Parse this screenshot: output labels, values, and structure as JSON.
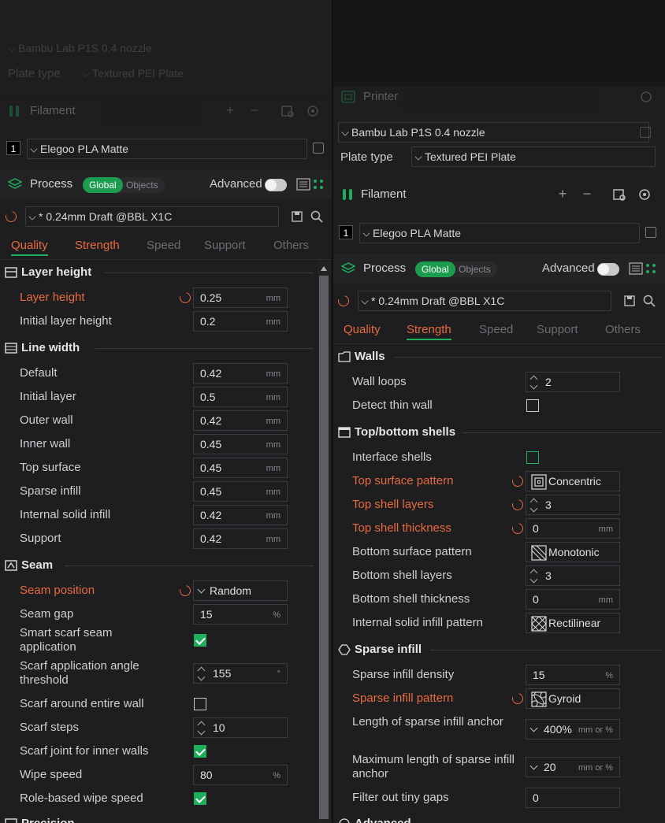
{
  "left": {
    "printer": {
      "preset": "Bambu Lab P1S 0.4 nozzle",
      "plate_label": "Plate type",
      "plate_value": "Textured PEI Plate"
    },
    "filament": {
      "title": "Filament",
      "slot": "1",
      "preset": "Elegoo PLA Matte"
    },
    "process": {
      "title": "Process",
      "global": "Global",
      "objects": "Objects",
      "advanced": "Advanced",
      "preset": "* 0.24mm Draft @BBL X1C"
    },
    "tabs": [
      "Quality",
      "Strength",
      "Speed",
      "Support",
      "Others"
    ],
    "sections": [
      {
        "title": "Layer height"
      },
      {
        "title": "Line width"
      },
      {
        "title": "Seam"
      },
      {
        "title": "Precision"
      }
    ],
    "rows": [
      {
        "label": "Layer height",
        "value": "0.25",
        "unit": "mm"
      },
      {
        "label": "Initial layer height",
        "value": "0.2",
        "unit": "mm"
      },
      {
        "label": "Default",
        "value": "0.42",
        "unit": "mm"
      },
      {
        "label": "Initial layer",
        "value": "0.5",
        "unit": "mm"
      },
      {
        "label": "Outer wall",
        "value": "0.42",
        "unit": "mm"
      },
      {
        "label": "Inner wall",
        "value": "0.45",
        "unit": "mm"
      },
      {
        "label": "Top surface",
        "value": "0.45",
        "unit": "mm"
      },
      {
        "label": "Sparse infill",
        "value": "0.45",
        "unit": "mm"
      },
      {
        "label": "Internal solid infill",
        "value": "0.42",
        "unit": "mm"
      },
      {
        "label": "Support",
        "value": "0.42",
        "unit": "mm"
      },
      {
        "label": "Seam position",
        "value": "Random"
      },
      {
        "label": "Seam gap",
        "value": "15",
        "unit": "%"
      },
      {
        "label": "Smart scarf seam application"
      },
      {
        "label": "Scarf application angle threshold",
        "value": "155",
        "unit": "°"
      },
      {
        "label": "Scarf around entire wall"
      },
      {
        "label": "Scarf steps",
        "value": "10"
      },
      {
        "label": "Scarf joint for inner walls"
      },
      {
        "label": "Wipe speed",
        "value": "80",
        "unit": "%"
      },
      {
        "label": "Role-based wipe speed"
      }
    ]
  },
  "right": {
    "printer": {
      "title": "Printer",
      "preset": "Bambu Lab P1S 0.4 nozzle",
      "plate_label": "Plate type",
      "plate_value": "Textured PEI Plate"
    },
    "filament": {
      "title": "Filament",
      "slot": "1",
      "preset": "Elegoo PLA Matte"
    },
    "process": {
      "title": "Process",
      "global": "Global",
      "objects": "Objects",
      "advanced": "Advanced",
      "preset": "* 0.24mm Draft @BBL X1C"
    },
    "tabs": [
      "Quality",
      "Strength",
      "Speed",
      "Support",
      "Others"
    ],
    "sections": [
      {
        "title": "Walls"
      },
      {
        "title": "Top/bottom shells"
      },
      {
        "title": "Sparse infill"
      },
      {
        "title": "Advanced"
      }
    ],
    "rows": [
      {
        "label": "Wall loops",
        "value": "2"
      },
      {
        "label": "Detect thin wall"
      },
      {
        "label": "Interface shells"
      },
      {
        "label": "Top surface pattern",
        "value": "Concentric"
      },
      {
        "label": "Top shell layers",
        "value": "3"
      },
      {
        "label": "Top shell thickness",
        "value": "0",
        "unit": "mm"
      },
      {
        "label": "Bottom surface pattern",
        "value": "Monotonic"
      },
      {
        "label": "Bottom shell layers",
        "value": "3"
      },
      {
        "label": "Bottom shell thickness",
        "value": "0",
        "unit": "mm"
      },
      {
        "label": "Internal solid infill pattern",
        "value": "Rectilinear"
      },
      {
        "label": "Sparse infill density",
        "value": "15",
        "unit": "%"
      },
      {
        "label": "Sparse infill pattern",
        "value": "Gyroid"
      },
      {
        "label": "Length of sparse infill anchor",
        "value": "400%",
        "unit": "mm or %"
      },
      {
        "label": "Maximum length of sparse infill anchor",
        "value": "20",
        "unit": "mm or %"
      },
      {
        "label": "Filter out tiny gaps",
        "value": "0"
      }
    ]
  },
  "colors": {
    "accent_green": "#1fae5b",
    "modified_orange": "#e86a3f",
    "background": "#1e1e20"
  }
}
